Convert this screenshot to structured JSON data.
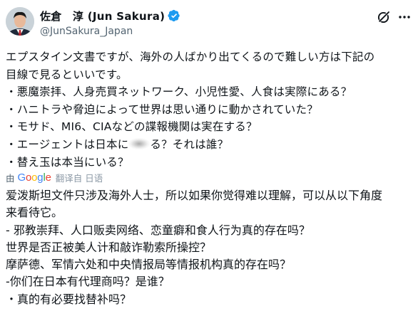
{
  "tweet": {
    "display_name": "佐倉　淳 (Jun Sakura)",
    "handle": "@JunSakura_Japan",
    "original_lines": [
      "エプスタイン文書ですが、海外の人ばかり出てくるので難しい方は下記の",
      "目線で見るといいです。",
      "・悪魔崇拝、人身売買ネットワーク、小児性愛、人食は実際にある？",
      "・ハニトラや脅迫によって世界は思い通りに動かされていた？",
      "・モサド、MI6、CIAなどの諜報機関は実在する？"
    ],
    "original_line6_before": "・エージェントは日本に",
    "original_line6_after": "る？それは誰？",
    "original_line7": "・替え玉は本当にいる？",
    "translation": {
      "by_label": "由",
      "provider": "Google",
      "label": "翻译自 日语"
    },
    "translated_lines": [
      "爱泼斯坦文件只涉及海外人士，所以如果你觉得难以理解，可以从以下角度",
      "来看待它。",
      "- 邪教崇拜、人口贩卖网络、恋童癖和食人行为真的存在吗？",
      "世界是否正被美人计和敲诈勒索所操控？",
      "摩萨德、军情六处和中央情报局等情报机构真的存在吗？",
      "-你们在日本有代理商吗？是谁？",
      "・真的有必要找替补吗？"
    ]
  },
  "icons": {
    "verified": "verified-badge-icon",
    "grok": "grok-icon",
    "more": "more-options-icon"
  },
  "colors": {
    "verified_blue": "#1d9bf0",
    "secondary_text": "#536471",
    "google_blue": "#4285f4",
    "google_red": "#ea4335",
    "google_yellow": "#fbbc05",
    "google_green": "#34a853"
  }
}
